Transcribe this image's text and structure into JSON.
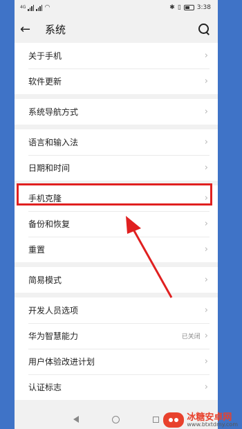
{
  "status": {
    "left_label": "4G",
    "time": "3:38",
    "battery_level": 0.6
  },
  "header": {
    "title": "系统"
  },
  "groups": [
    {
      "rows": [
        {
          "label": "关于手机"
        },
        {
          "label": "软件更新"
        }
      ]
    },
    {
      "rows": [
        {
          "label": "系统导航方式"
        }
      ]
    },
    {
      "rows": [
        {
          "label": "语言和输入法"
        },
        {
          "label": "日期和时间"
        }
      ]
    },
    {
      "rows": [
        {
          "label": "手机克隆"
        },
        {
          "label": "备份和恢复"
        },
        {
          "label": "重置"
        }
      ]
    },
    {
      "rows": [
        {
          "label": "简易模式"
        }
      ]
    },
    {
      "rows": [
        {
          "label": "开发人员选项"
        },
        {
          "label": "华为智慧能力",
          "value": "已关闭"
        },
        {
          "label": "用户体验改进计划"
        },
        {
          "label": "认证标志"
        }
      ]
    }
  ],
  "watermark": {
    "cn": "冰糖安卓网",
    "en": "www.btxtdmy.com"
  },
  "colors": {
    "highlight": "#e02020",
    "arrow": "#e02020"
  }
}
